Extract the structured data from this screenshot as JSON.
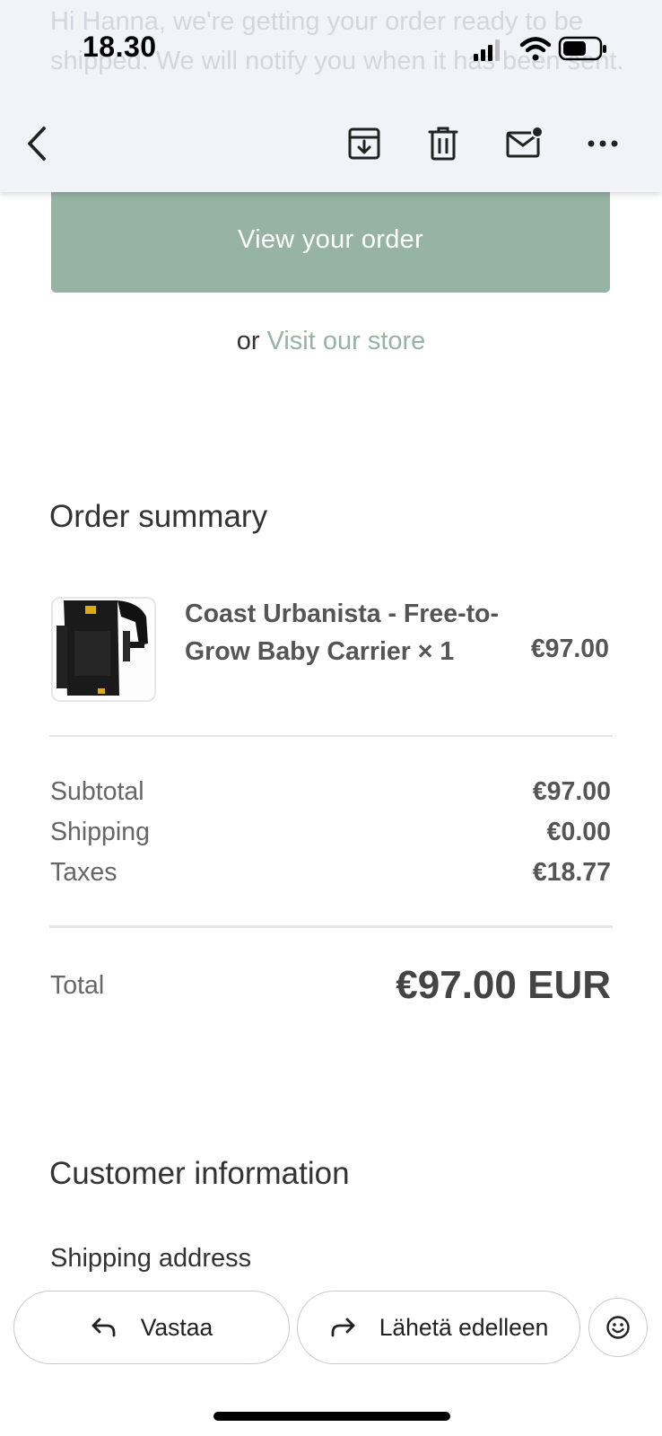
{
  "status_bar": {
    "time": "18.30"
  },
  "email_preview_text": "Hi Hanna, we're getting your order ready to be shipped. We will notify you when it has been sent.",
  "toolbar": {
    "back_icon": "chevron-left-icon",
    "archive_icon": "archive-icon",
    "delete_icon": "trash-icon",
    "mark_unread_icon": "mail-unread-icon",
    "more_icon": "more-horizontal-icon"
  },
  "cta": {
    "view_order_label": "View your order",
    "or_text": "or",
    "visit_store_label": "Visit our store"
  },
  "order_summary": {
    "title": "Order summary",
    "item": {
      "name": "Coast Urbanista - Free-to-Grow Baby Carrier × 1",
      "price": "€97.00"
    },
    "rows": [
      {
        "label": "Subtotal",
        "value": "€97.00"
      },
      {
        "label": "Shipping",
        "value": "€0.00"
      },
      {
        "label": "Taxes",
        "value": "€18.77"
      }
    ],
    "total_label": "Total",
    "total_value": "€97.00 EUR"
  },
  "customer_info": {
    "title": "Customer information",
    "shipping_address_label": "Shipping address"
  },
  "actions": {
    "reply_label": "Vastaa",
    "forward_label": "Lähetä edelleen",
    "emoji_icon": "smiley-icon"
  },
  "colors": {
    "accent": "#97b3a4",
    "toolbar_bg": "#f2f3f8",
    "text": "#333333"
  }
}
